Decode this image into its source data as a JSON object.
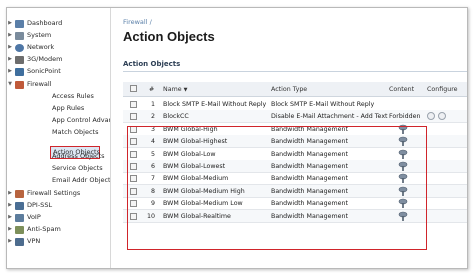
{
  "breadcrumb": "Firewall /",
  "page_title": "Action Objects",
  "section_title": "Action Objects",
  "colors": {
    "highlight": "#d0252b",
    "selected_bg": "#dde7f3",
    "header_bg": "#eef1f5",
    "link": "#5a7fa8"
  },
  "sidebar": {
    "items": [
      {
        "label": "Dashboard",
        "icon": "dashboard-icon",
        "expanded": false
      },
      {
        "label": "System",
        "icon": "system-icon",
        "expanded": false
      },
      {
        "label": "Network",
        "icon": "network-icon",
        "expanded": false
      },
      {
        "label": "3G/Modem",
        "icon": "modem-icon",
        "expanded": false
      },
      {
        "label": "SonicPoint",
        "icon": "sonicpoint-icon",
        "expanded": false
      },
      {
        "label": "Firewall",
        "icon": "firewall-icon",
        "expanded": true
      },
      {
        "label": "Firewall Settings",
        "icon": "firewall-settings-icon",
        "expanded": false
      },
      {
        "label": "DPI-SSL",
        "icon": "dpi-ssl-icon",
        "expanded": false
      },
      {
        "label": "VoIP",
        "icon": "voip-icon",
        "expanded": false
      },
      {
        "label": "Anti-Spam",
        "icon": "anti-spam-icon",
        "expanded": false
      },
      {
        "label": "VPN",
        "icon": "vpn-icon",
        "expanded": false
      }
    ],
    "firewall_children": [
      "Access Rules",
      "App Rules",
      "App Control Advanced",
      "Match Objects",
      "Action Objects",
      "Address Objects",
      "Service Objects",
      "Email Addr Objects"
    ],
    "selected": "Action Objects"
  },
  "table": {
    "columns": {
      "number": "#",
      "name": "Name",
      "action_type": "Action Type",
      "content": "Content",
      "configure": "Configure"
    },
    "sort_indicator": "▼",
    "rows": [
      {
        "num": "1",
        "name": "Block SMTP E-Mail Without Reply",
        "action_type": "Block SMTP E-Mail Without Reply",
        "content": "",
        "has_icon": false,
        "configure": false
      },
      {
        "num": "2",
        "name": "BlockCC",
        "action_type": "Disable E-Mail Attachment - Add Text",
        "content": "Forbidden",
        "has_icon": false,
        "configure": true
      },
      {
        "num": "3",
        "name": "BWM Global-High",
        "action_type": "Bandwidth Management",
        "content": "",
        "has_icon": true,
        "configure": false
      },
      {
        "num": "4",
        "name": "BWM Global-Highest",
        "action_type": "Bandwidth Management",
        "content": "",
        "has_icon": true,
        "configure": false
      },
      {
        "num": "5",
        "name": "BWM Global-Low",
        "action_type": "Bandwidth Management",
        "content": "",
        "has_icon": true,
        "configure": false
      },
      {
        "num": "6",
        "name": "BWM Global-Lowest",
        "action_type": "Bandwidth Management",
        "content": "",
        "has_icon": true,
        "configure": false
      },
      {
        "num": "7",
        "name": "BWM Global-Medium",
        "action_type": "Bandwidth Management",
        "content": "",
        "has_icon": true,
        "configure": false
      },
      {
        "num": "8",
        "name": "BWM Global-Medium High",
        "action_type": "Bandwidth Management",
        "content": "",
        "has_icon": true,
        "configure": false
      },
      {
        "num": "9",
        "name": "BWM Global-Medium Low",
        "action_type": "Bandwidth Management",
        "content": "",
        "has_icon": true,
        "configure": false
      },
      {
        "num": "10",
        "name": "BWM Global-Realtime",
        "action_type": "Bandwidth Management",
        "content": "",
        "has_icon": true,
        "configure": false
      }
    ]
  }
}
